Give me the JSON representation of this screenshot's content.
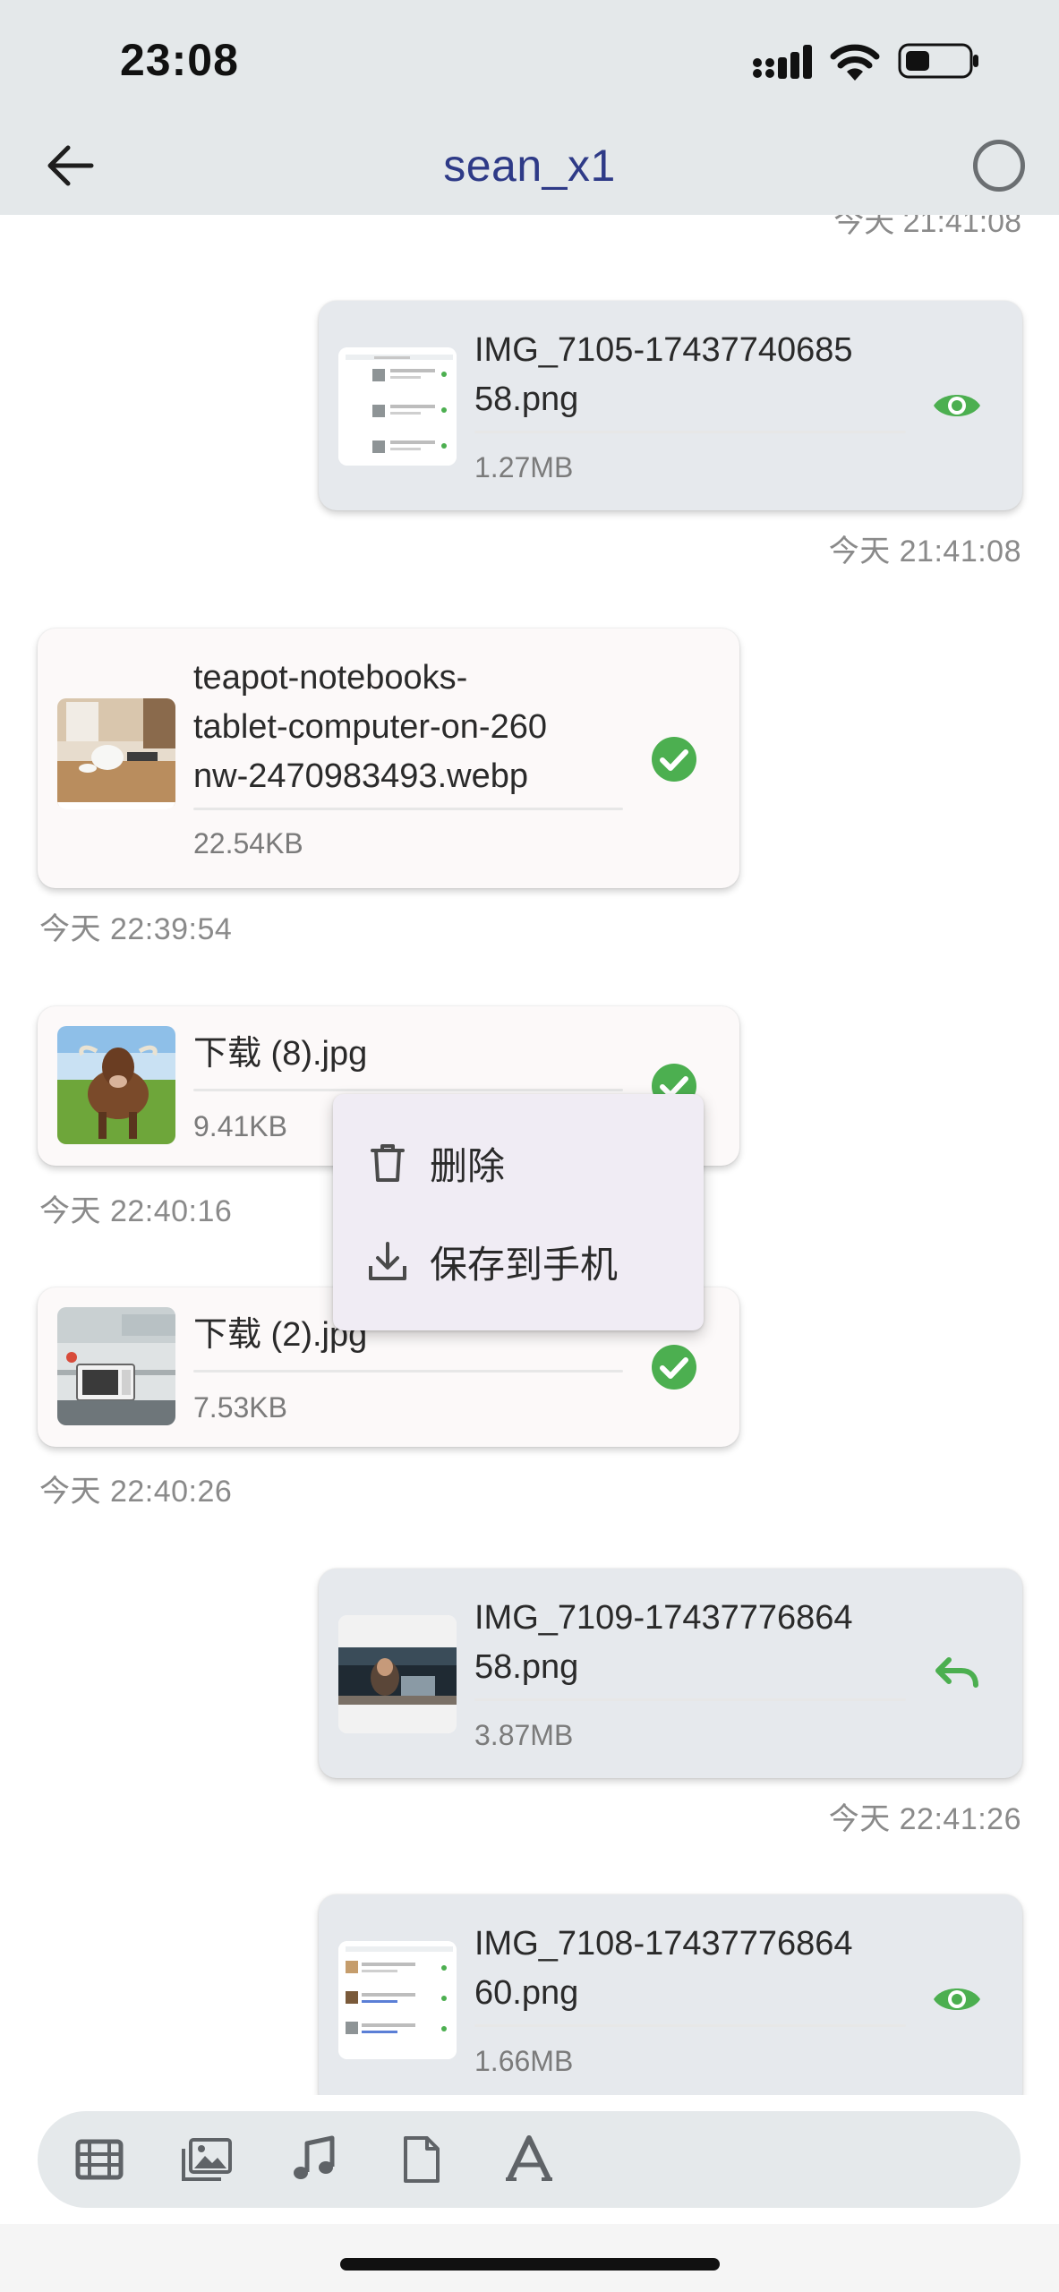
{
  "status_bar": {
    "time": "23:08"
  },
  "header": {
    "title": "sean_x1"
  },
  "clipped_timestamp": "今天 21:41:08",
  "messages": [
    {
      "direction": "out",
      "name": "IMG_7105-17437740685\n58.png",
      "size": "1.27MB",
      "status": "eye-icon",
      "time": "今天 21:41:08"
    },
    {
      "direction": "in",
      "name": "teapot-notebooks-\ntablet-computer-on-260\nnw-2470983493.webp",
      "size": "22.54KB",
      "status": "check-icon",
      "time": "今天 22:39:54"
    },
    {
      "direction": "in",
      "name": "下载 (8).jpg",
      "size": "9.41KB",
      "status": "check-icon",
      "time": "今天 22:40:16"
    },
    {
      "direction": "in",
      "name": "下载 (2).jpg",
      "size": "7.53KB",
      "status": "check-icon",
      "time": "今天 22:40:26"
    },
    {
      "direction": "out",
      "name": "IMG_7109-17437776864\n58.png",
      "size": "3.87MB",
      "status": "undo-icon",
      "time": "今天 22:41:26"
    },
    {
      "direction": "out",
      "name": "IMG_7108-17437776864\n60.png",
      "size": "1.66MB",
      "status": "eye-icon",
      "time": ""
    }
  ],
  "context_menu": {
    "delete_label": "删除",
    "save_label": "保存到手机"
  },
  "toolbar": {
    "items": [
      "video-icon",
      "image-icon",
      "music-icon",
      "file-icon",
      "text-icon"
    ]
  },
  "colors": {
    "accent_title": "#2e3a87",
    "success_green": "#4caf50",
    "header_bg": "#e4e8ea",
    "bubble_out": "#e6e9ed",
    "bubble_in": "#fcf9f9",
    "menu_bg": "#f0ecf4"
  }
}
